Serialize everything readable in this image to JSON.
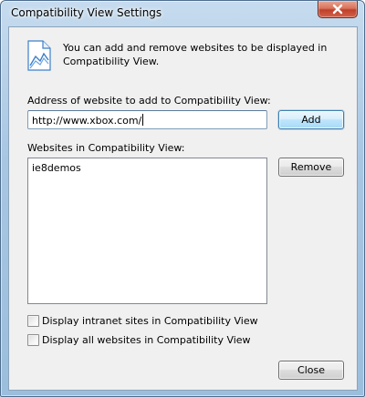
{
  "window": {
    "title": "Compatibility View Settings"
  },
  "info": {
    "icon": "compat-view-icon",
    "text": "You can add and remove websites to be displayed in Compatibility View."
  },
  "address": {
    "label": "Address of website to add to Compatibility View:",
    "value": "http://www.xbox.com/",
    "add_label": "Add"
  },
  "websites": {
    "label": "Websites in Compatibility View:",
    "items": [
      "ie8demos"
    ],
    "remove_label": "Remove"
  },
  "options": [
    {
      "label": "Display intranet sites in Compatibility View",
      "checked": false
    },
    {
      "label": "Display all websites in Compatibility View",
      "checked": false
    }
  ],
  "footer": {
    "close_label": "Close"
  }
}
